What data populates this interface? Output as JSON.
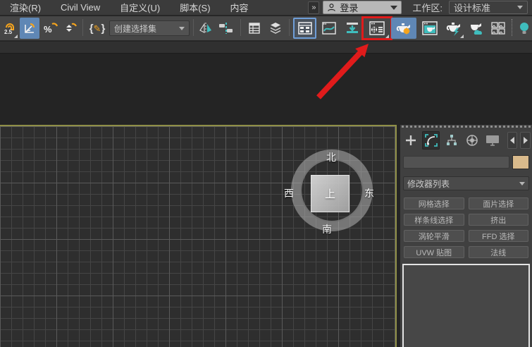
{
  "menubar": {
    "items": [
      {
        "label": "渲染(R)"
      },
      {
        "label": "Civil View"
      },
      {
        "label": "自定义(U)"
      },
      {
        "label": "脚本(S)"
      },
      {
        "label": "内容"
      }
    ],
    "overflow_chevron": "»",
    "login_label": "登录",
    "workspace_label": "工作区:",
    "workspace_value": "设计标准"
  },
  "toolbar": {
    "selection_set_value": "创建选择集",
    "glyph_snap": "2.5",
    "glyph_percent": "%",
    "glyph_brace_left": "{",
    "glyph_pencil": "✎",
    "glyph_brace_right": "}"
  },
  "viewport": {
    "compass": {
      "north": "北",
      "south": "南",
      "west": "西",
      "east": "东",
      "top": "上"
    }
  },
  "panel": {
    "modifier_list_label": "修改器列表",
    "buttons": [
      "网格选择",
      "面片选择",
      "样条线选择",
      "挤出",
      "涡轮平滑",
      "FFD 选择",
      "UVW 贴图",
      "法线"
    ]
  },
  "annotation": {
    "color": "#e01b1b"
  },
  "colors": {
    "viewport_border": "#8f8f46",
    "highlight_blue": "#5f87b5",
    "accent_teal": "#3fbdbd",
    "accent_orange": "#f5a41d",
    "swatch": "#d9ba8c"
  }
}
